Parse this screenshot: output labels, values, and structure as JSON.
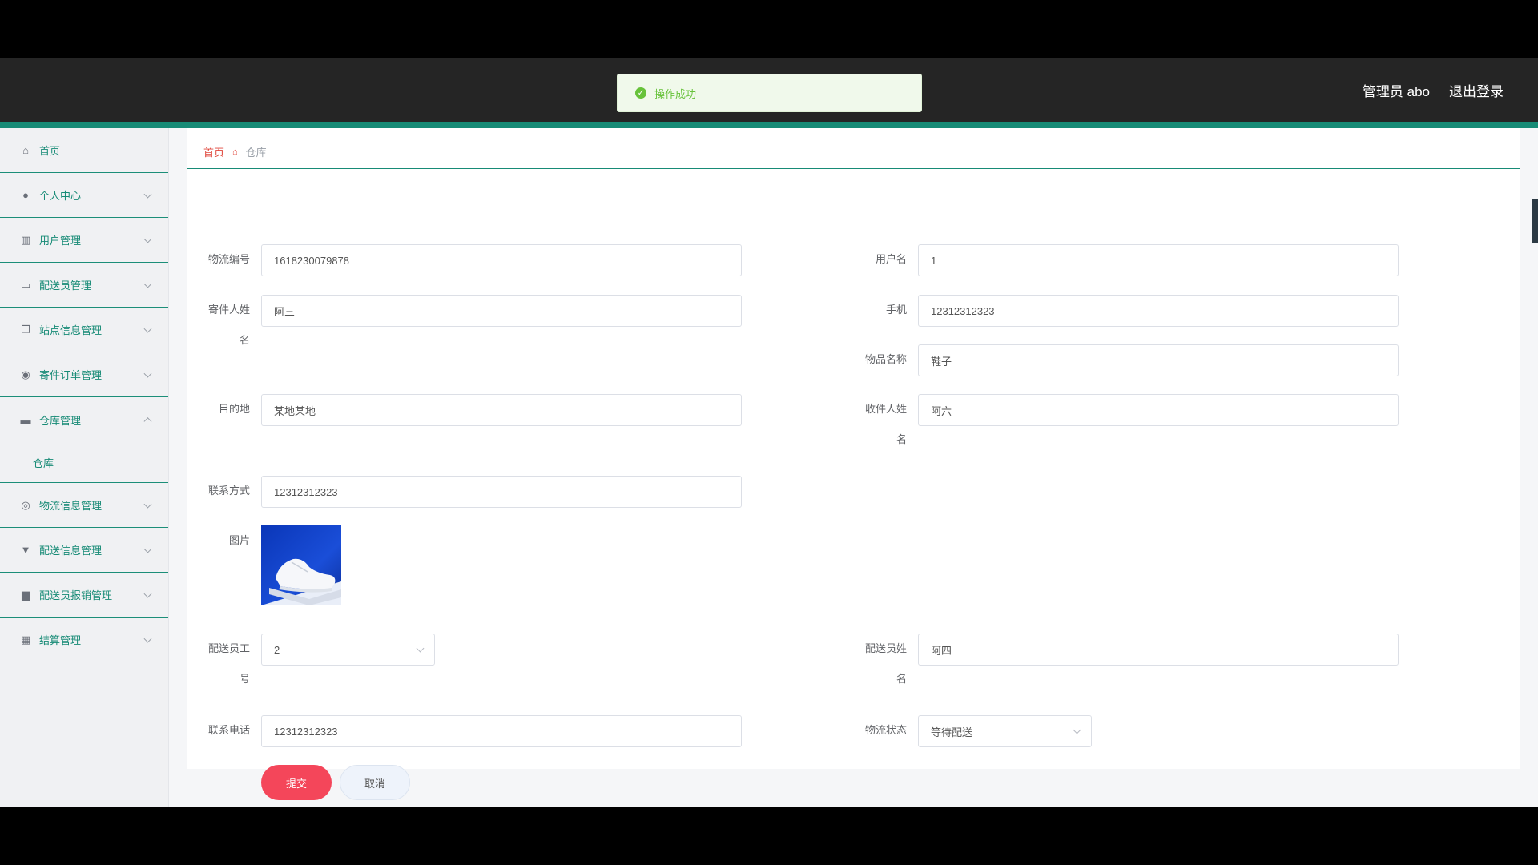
{
  "header": {
    "admin_label": "管理员 abo",
    "logout_label": "退出登录"
  },
  "toast": {
    "message": "操作成功"
  },
  "sidebar": {
    "items": [
      {
        "label": "首页",
        "icon": "home-icon"
      },
      {
        "label": "个人中心",
        "icon": "user-icon"
      },
      {
        "label": "用户管理",
        "icon": "users-icon"
      },
      {
        "label": "配送员管理",
        "icon": "id-card-icon"
      },
      {
        "label": "站点信息管理",
        "icon": "copy-icon"
      },
      {
        "label": "寄件订单管理",
        "icon": "location-icon"
      },
      {
        "label": "仓库管理",
        "icon": "briefcase-icon"
      },
      {
        "label": "物流信息管理",
        "icon": "target-icon"
      },
      {
        "label": "配送信息管理",
        "icon": "stamp-icon"
      },
      {
        "label": "配送员报销管理",
        "icon": "printer-icon"
      },
      {
        "label": "结算管理",
        "icon": "grid-icon"
      }
    ],
    "sub_item": "仓库"
  },
  "breadcrumb": {
    "home": "首页",
    "current": "仓库"
  },
  "form": {
    "tracking_no": {
      "label": "物流编号",
      "value": "1618230079878"
    },
    "username": {
      "label": "用户名",
      "value": "1"
    },
    "sender_name": {
      "label": "寄件人姓名",
      "value": "阿三"
    },
    "phone": {
      "label": "手机",
      "value": "12312312323"
    },
    "item_name": {
      "label": "物品名称",
      "value": "鞋子"
    },
    "destination": {
      "label": "目的地",
      "value": "某地某地"
    },
    "recipient_name": {
      "label": "收件人姓名",
      "value": "阿六"
    },
    "contact": {
      "label": "联系方式",
      "value": "12312312323"
    },
    "image": {
      "label": "图片"
    },
    "courier_id": {
      "label": "配送员工号",
      "value": "2"
    },
    "courier_name": {
      "label": "配送员姓名",
      "value": "阿四"
    },
    "contact_phone": {
      "label": "联系电话",
      "value": "12312312323"
    },
    "status": {
      "label": "物流状态",
      "value": "等待配送"
    },
    "submit_label": "提交",
    "cancel_label": "取消"
  },
  "colors": {
    "accent": "#178b76",
    "danger": "#f4465a",
    "success": "#67c23a"
  }
}
